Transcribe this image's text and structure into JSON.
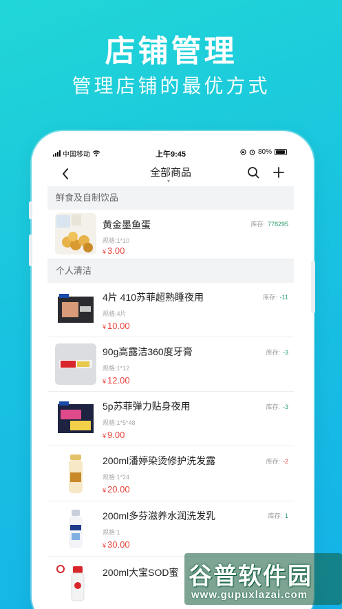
{
  "hero": {
    "title": "店铺管理",
    "subtitle": "管理店铺的最优方式"
  },
  "status_bar": {
    "carrier": "中国移动",
    "time": "上午9:45",
    "battery": "80%"
  },
  "navbar": {
    "back_icon": "chevron-left-icon",
    "title": "全部商品",
    "search_icon": "search-icon",
    "add_icon": "plus-icon"
  },
  "sections": [
    {
      "label": "鲜食及自制饮品"
    },
    {
      "label": "个人清洁"
    }
  ],
  "stock_label": "库存:",
  "currency": "¥",
  "products": [
    {
      "name": "黄金墨鱼蛋",
      "spec": "规格:1*10",
      "price": "3.00",
      "stock": "778295",
      "stock_color": "#2a9d6b"
    },
    {
      "name": "4片 410苏菲超熟睡夜用",
      "spec": "规格:4片",
      "price": "10.00",
      "stock": "-11",
      "stock_color": "#2a9d6b"
    },
    {
      "name": "90g高露洁360度牙膏",
      "spec": "规格:1*12",
      "price": "12.00",
      "stock": "-3",
      "stock_color": "#2a9d6b"
    },
    {
      "name": "5p苏菲弹力贴身夜用",
      "spec": "规格:1*5*48",
      "price": "9.00",
      "stock": "-3",
      "stock_color": "#2a9d6b"
    },
    {
      "name": "200ml潘婷染烫修护洗发露",
      "spec": "规格:1*24",
      "price": "20.00",
      "stock": "-2",
      "stock_color": "#e8453c"
    },
    {
      "name": "200ml多芬滋养水润洗发乳",
      "spec": "规格:1",
      "price": "30.00",
      "stock": "1",
      "stock_color": "#2a9d6b"
    },
    {
      "name": "200ml大宝SOD蜜",
      "spec": "",
      "price": "",
      "stock": "",
      "stock_color": "#2a9d6b"
    }
  ],
  "watermark": {
    "text": "谷普软件园",
    "url": "www.gupuxlazai.com"
  }
}
